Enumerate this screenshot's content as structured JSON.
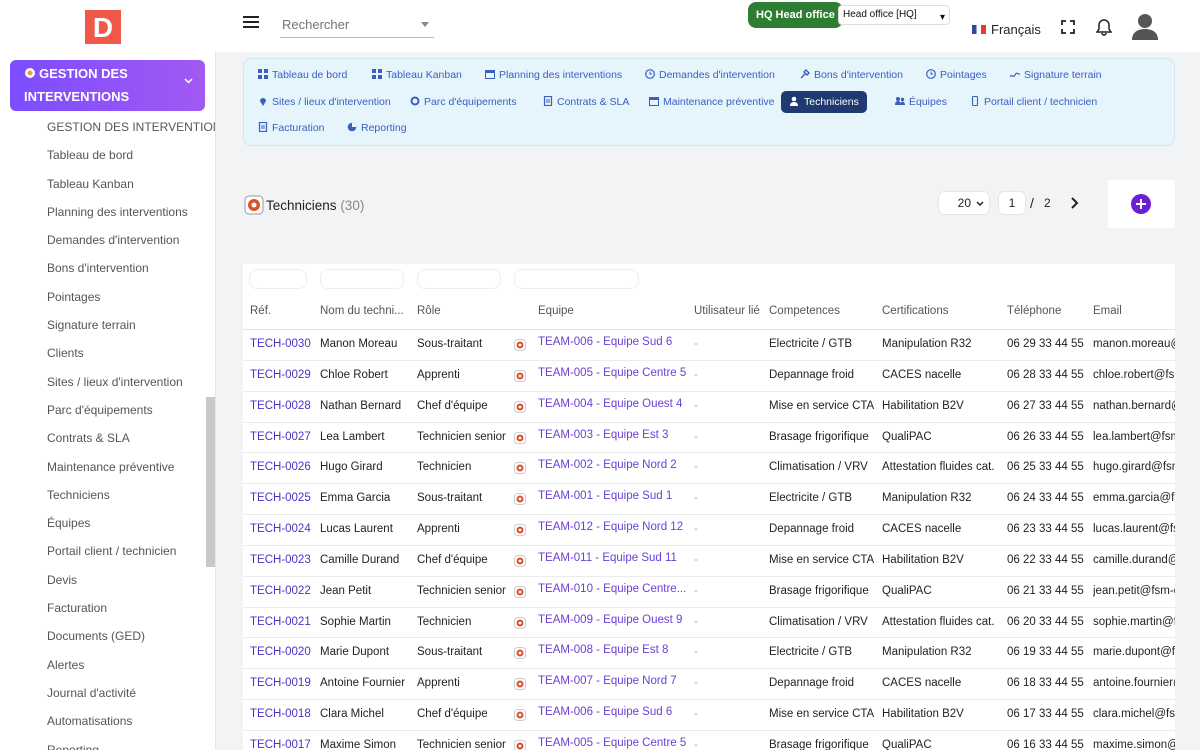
{
  "logo": {
    "letter": "D"
  },
  "header": {
    "search_placeholder": "Rechercher",
    "hq_badge": "HQ Head office",
    "hq_select": "Head office [HQ]",
    "language": "Français"
  },
  "sidebar": {
    "module_title_line1": "GESTION DES",
    "module_title_line2": "INTERVENTIONS",
    "items": [
      "GESTION DES INTERVENTIONS",
      "Tableau de bord",
      "Tableau Kanban",
      "Planning des interventions",
      "Demandes d'intervention",
      "Bons d'intervention",
      "Pointages",
      "Signature terrain",
      "Clients",
      "Sites / lieux d'intervention",
      "Parc d'équipements",
      "Contrats & SLA",
      "Maintenance préventive",
      "Techniciens",
      "Équipes",
      "Portail client / technicien",
      "Devis",
      "Facturation",
      "Documents (GED)",
      "Alertes",
      "Journal d'activité",
      "Automatisations",
      "Reporting"
    ]
  },
  "menu": {
    "items": [
      {
        "label": "Tableau de bord"
      },
      {
        "label": "Tableau Kanban"
      },
      {
        "label": "Planning des interventions"
      },
      {
        "label": "Demandes d'intervention"
      },
      {
        "label": "Bons d'intervention"
      },
      {
        "label": "Pointages"
      },
      {
        "label": "Signature terrain"
      },
      {
        "label": "Sites / lieux d'intervention"
      },
      {
        "label": "Parc d'équipements"
      },
      {
        "label": "Contrats & SLA"
      },
      {
        "label": "Maintenance préventive"
      },
      {
        "label": "Techniciens"
      },
      {
        "label": "Équipes"
      },
      {
        "label": "Portail client / technicien"
      },
      {
        "label": "Facturation"
      },
      {
        "label": "Reporting"
      }
    ],
    "active": "Techniciens"
  },
  "content": {
    "title": "Techniciens",
    "count": "(30)",
    "page_size": "20",
    "page_current": "1",
    "page_separator": "/",
    "page_total": "2"
  },
  "table": {
    "columns": [
      "Réf.",
      "Nom du techni...",
      "Rôle",
      "Equipe",
      "Utilisateur lié",
      "Competences",
      "Certifications",
      "Téléphone",
      "Email"
    ],
    "rows": [
      [
        "TECH-0030",
        "Manon Moreau",
        "Sous-traitant",
        "TEAM-006 - Equipe Sud 6",
        "-",
        "Electricite / GTB",
        "Manipulation R32",
        "06 29 33 44 55",
        "manon.moreau@"
      ],
      [
        "TECH-0029",
        "Chloe Robert",
        "Apprenti",
        "TEAM-005 - Equipe Centre 5",
        "-",
        "Depannage froid",
        "CACES nacelle",
        "06 28 33 44 55",
        "chloe.robert@fsm"
      ],
      [
        "TECH-0028",
        "Nathan Bernard",
        "Chef d'équipe",
        "TEAM-004 - Equipe Ouest 4",
        "-",
        "Mise en service CTA",
        "Habilitation B2V",
        "06 27 33 44 55",
        "nathan.bernard@"
      ],
      [
        "TECH-0027",
        "Lea Lambert",
        "Technicien senior",
        "TEAM-003 - Equipe Est 3",
        "-",
        "Brasage frigorifique",
        "QualiPAC",
        "06 26 33 44 55",
        "lea.lambert@fsm"
      ],
      [
        "TECH-0026",
        "Hugo Girard",
        "Technicien",
        "TEAM-002 - Equipe Nord 2",
        "-",
        "Climatisation / VRV",
        "Attestation fluides cat. I",
        "06 25 33 44 55",
        "hugo.girard@fsm"
      ],
      [
        "TECH-0025",
        "Emma Garcia",
        "Sous-traitant",
        "TEAM-001 - Equipe Sud 1",
        "-",
        "Electricite / GTB",
        "Manipulation R32",
        "06 24 33 44 55",
        "emma.garcia@fsm"
      ],
      [
        "TECH-0024",
        "Lucas Laurent",
        "Apprenti",
        "TEAM-012 - Equipe Nord 12",
        "-",
        "Depannage froid",
        "CACES nacelle",
        "06 23 33 44 55",
        "lucas.laurent@fsm"
      ],
      [
        "TECH-0023",
        "Camille Durand",
        "Chef d'équipe",
        "TEAM-011 - Equipe Sud 11",
        "-",
        "Mise en service CTA",
        "Habilitation B2V",
        "06 22 33 44 55",
        "camille.durand@"
      ],
      [
        "TECH-0022",
        "Jean Petit",
        "Technicien senior",
        "TEAM-010 - Equipe Centre...",
        "-",
        "Brasage frigorifique",
        "QualiPAC",
        "06 21 33 44 55",
        "jean.petit@fsm-d"
      ],
      [
        "TECH-0021",
        "Sophie Martin",
        "Technicien",
        "TEAM-009 - Equipe Ouest 9",
        "-",
        "Climatisation / VRV",
        "Attestation fluides cat. I",
        "06 20 33 44 55",
        "sophie.martin@fs"
      ],
      [
        "TECH-0020",
        "Marie Dupont",
        "Sous-traitant",
        "TEAM-008 - Equipe Est 8",
        "-",
        "Electricite / GTB",
        "Manipulation R32",
        "06 19 33 44 55",
        "marie.dupont@fsm"
      ],
      [
        "TECH-0019",
        "Antoine Fournier",
        "Apprenti",
        "TEAM-007 - Equipe Nord 7",
        "-",
        "Depannage froid",
        "CACES nacelle",
        "06 18 33 44 55",
        "antoine.fournier@"
      ],
      [
        "TECH-0018",
        "Clara Michel",
        "Chef d'équipe",
        "TEAM-006 - Equipe Sud 6",
        "-",
        "Mise en service CTA",
        "Habilitation B2V",
        "06 17 33 44 55",
        "clara.michel@fsm"
      ],
      [
        "TECH-0017",
        "Maxime Simon",
        "Technicien senior",
        "TEAM-005 - Equipe Centre 5",
        "-",
        "Brasage frigorifique",
        "QualiPAC",
        "06 16 33 44 55",
        "maxime.simon@"
      ]
    ]
  },
  "colors": {
    "accent": "#7c4dff",
    "ref_link": "#4a34c7",
    "team_link": "#6a3fd8",
    "active_tab": "#1e3a70",
    "hq_green": "#2f7d32",
    "logo_red": "#f0584a"
  }
}
